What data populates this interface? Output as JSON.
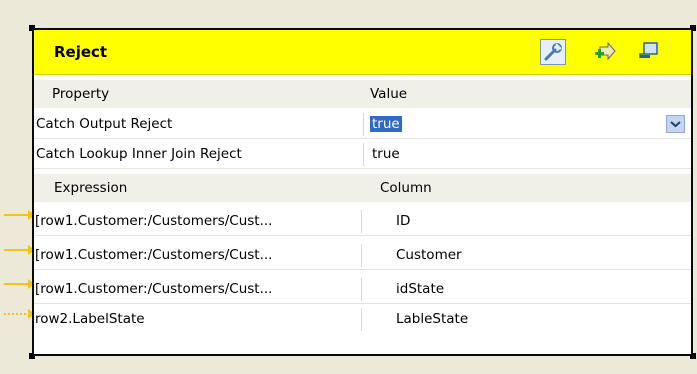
{
  "panel": {
    "title": "Reject",
    "toolbar_icons": [
      "wrench-icon",
      "add-input-icon",
      "minimize-icon"
    ]
  },
  "settings": {
    "header": {
      "property": "Property",
      "value": "Value"
    },
    "rows": [
      {
        "property": "Catch Output Reject",
        "value": "true",
        "has_dropdown": true
      },
      {
        "property": "Catch Lookup Inner Join Reject",
        "value": "true"
      }
    ]
  },
  "mapping": {
    "header": {
      "expression": "Expression",
      "column": "Column"
    },
    "rows": [
      {
        "expression": "[row1.Customer:/Customers/Cust...",
        "column": "ID"
      },
      {
        "expression": "[row1.Customer:/Customers/Cust...",
        "column": "Customer"
      },
      {
        "expression": "[row1.Customer:/Customers/Cust...",
        "column": "idState"
      },
      {
        "expression": "row2.LabelState",
        "column": "LableState"
      }
    ]
  },
  "colors": {
    "title_bar": "#ffff00",
    "connector": "#f4c21a",
    "selection": "#316ac5"
  }
}
